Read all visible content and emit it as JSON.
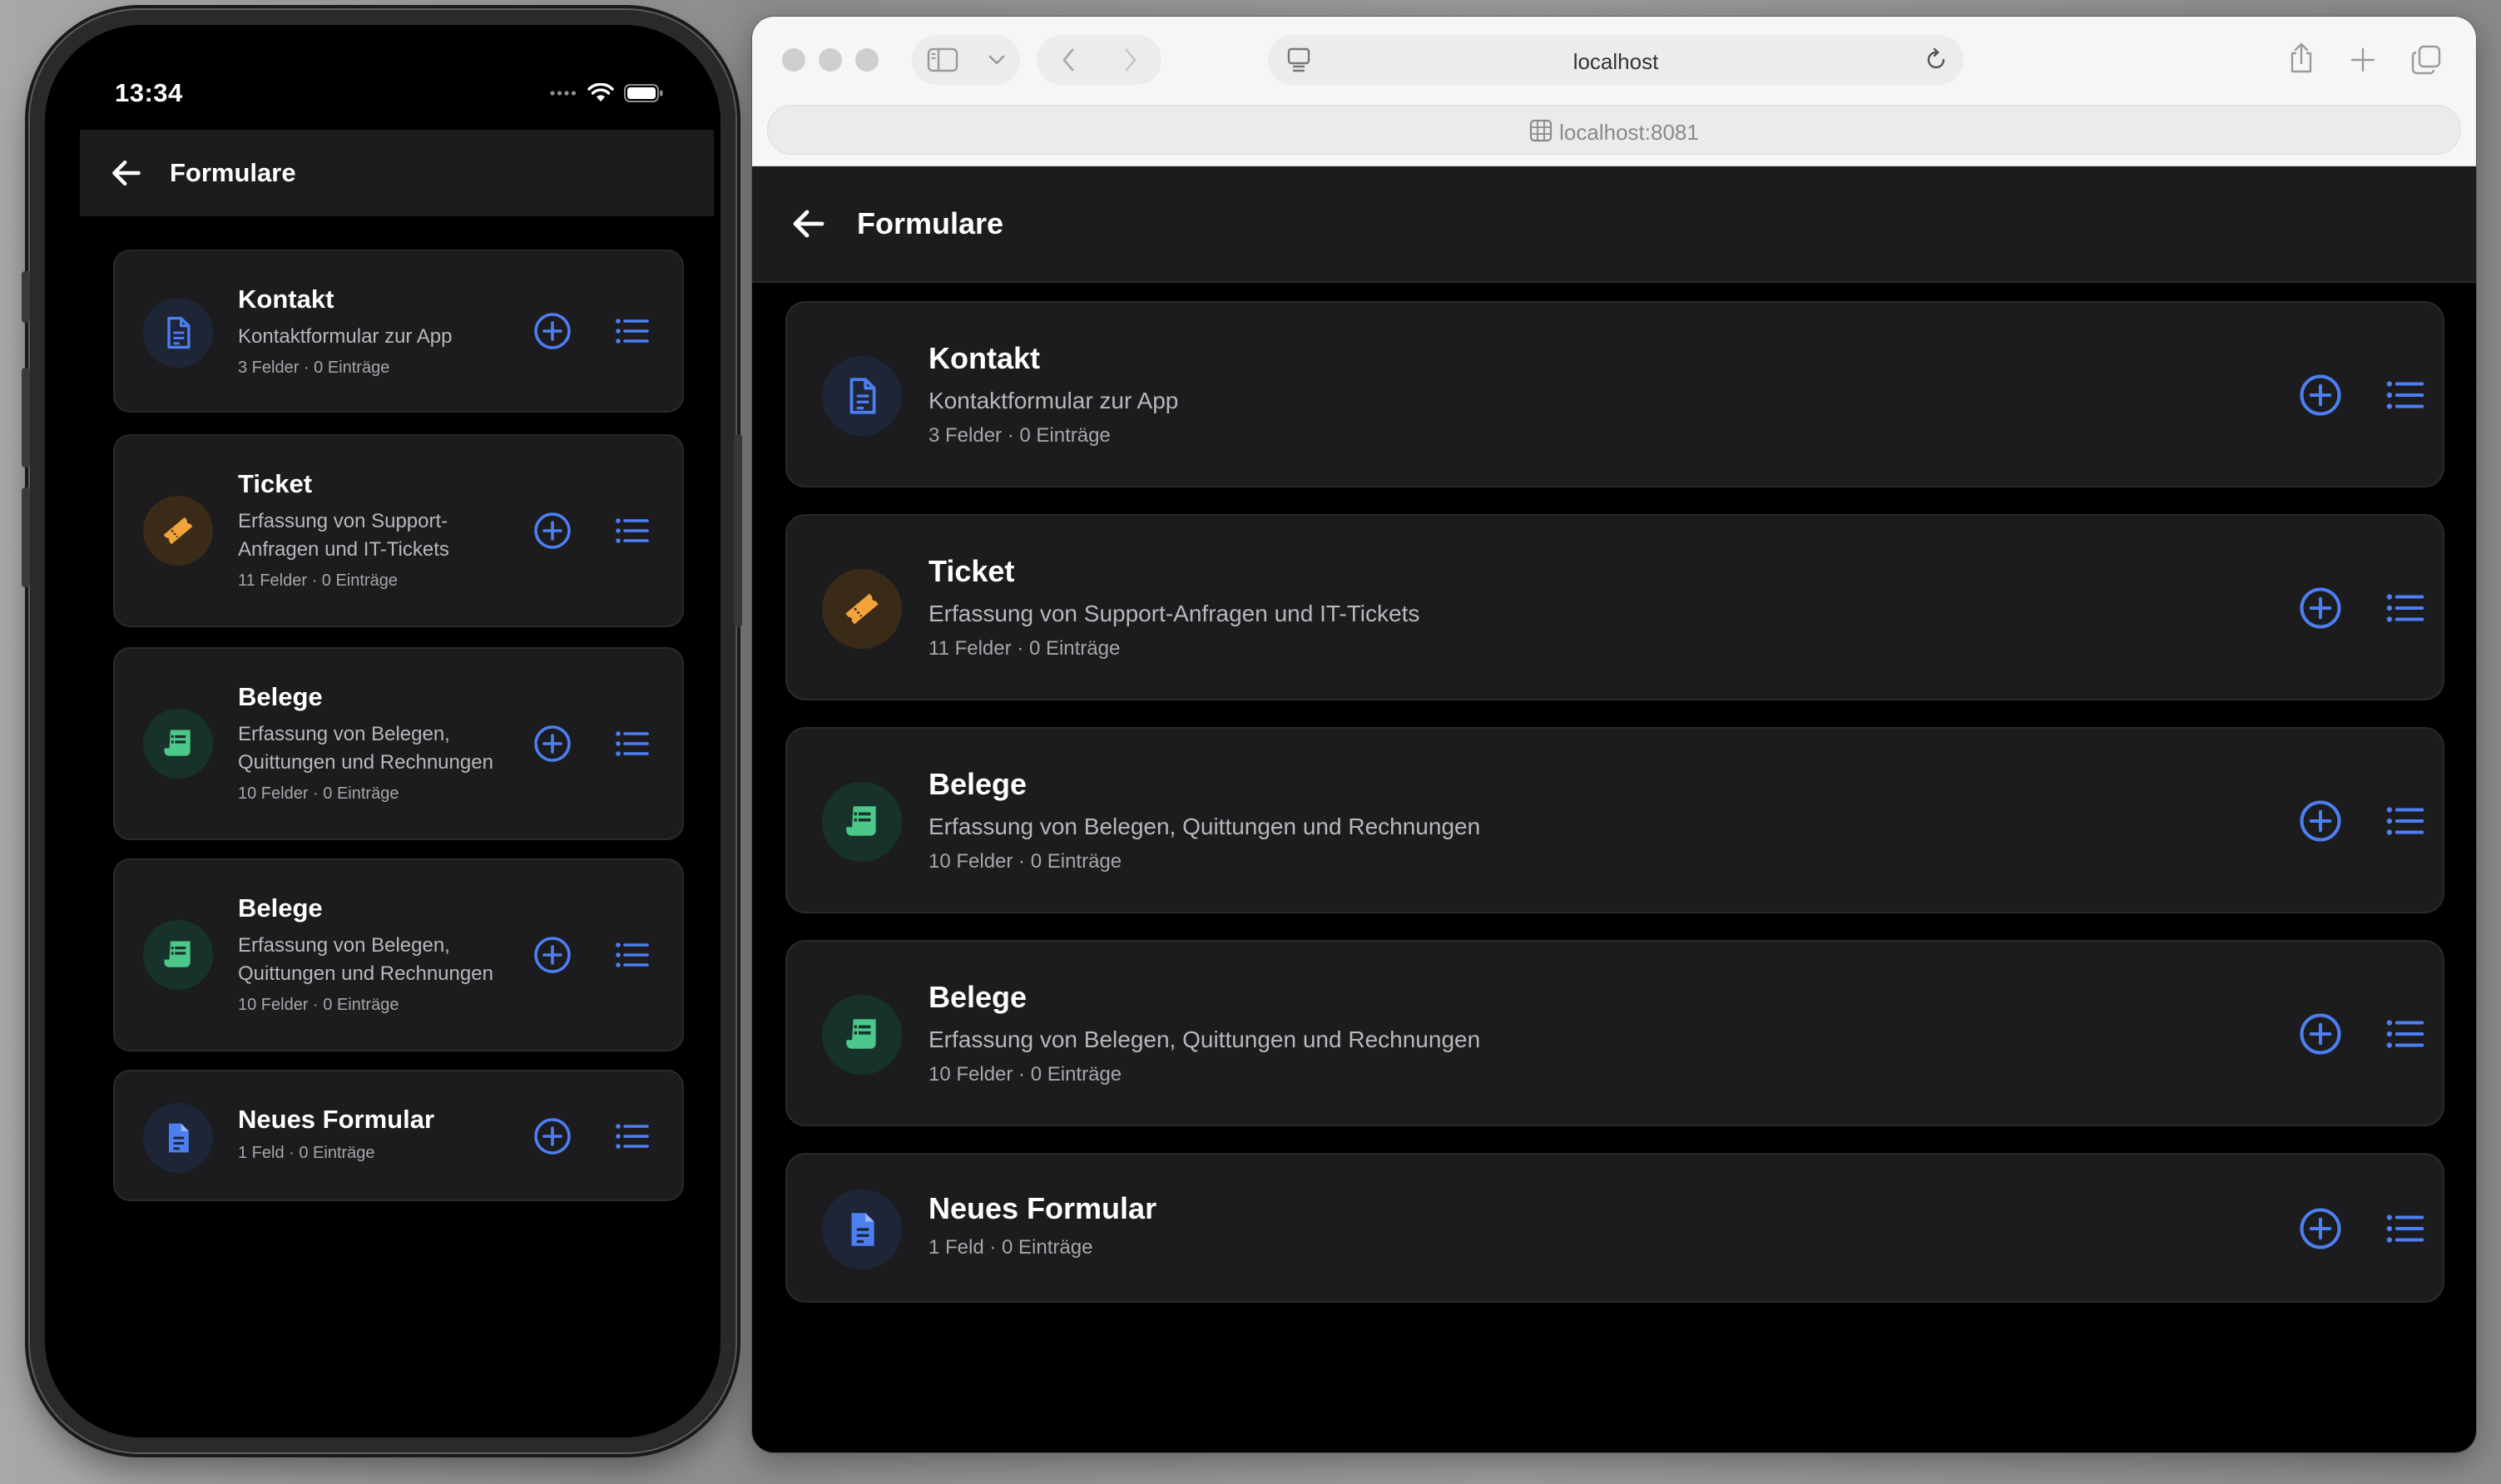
{
  "phone": {
    "status_time": "13:34",
    "appbar_title": "Formulare"
  },
  "browser": {
    "tab_url": "localhost",
    "address": "localhost:8081",
    "appbar_title": "Formulare"
  },
  "forms": [
    {
      "name": "Kontakt",
      "description": "Kontaktformular zur App",
      "phone_desc_lines": [
        "Kontaktformular zur App"
      ],
      "meta": "3 Felder · 0 Einträge",
      "icon": "document-outline-icon",
      "icon_color": "#4d7ff2",
      "icon_bg": "#1e2536"
    },
    {
      "name": "Ticket",
      "description": "Erfassung von Support-Anfragen und IT-Tickets",
      "phone_desc_lines": [
        "Erfassung von Support-",
        "Anfragen und IT-Tickets"
      ],
      "meta": "11 Felder · 0 Einträge",
      "icon": "ticket-icon",
      "icon_color": "#f2a43a",
      "icon_bg": "#3a2a18"
    },
    {
      "name": "Belege",
      "description": "Erfassung von Belegen, Quittungen und Rechnungen",
      "phone_desc_lines": [
        "Erfassung von Belegen,",
        "Quittungen und Rechnungen"
      ],
      "meta": "10 Felder · 0 Einträge",
      "icon": "receipt-icon",
      "icon_color": "#4cc88a",
      "icon_bg": "#17322a"
    },
    {
      "name": "Belege",
      "description": "Erfassung von Belegen, Quittungen und Rechnungen",
      "phone_desc_lines": [
        "Erfassung von Belegen,",
        "Quittungen und Rechnungen"
      ],
      "meta": "10 Felder · 0 Einträge",
      "icon": "receipt-icon",
      "icon_color": "#4cc88a",
      "icon_bg": "#17322a"
    },
    {
      "name": "Neues Formular",
      "description": "",
      "phone_desc_lines": [],
      "meta": "1 Feld · 0 Einträge",
      "icon": "document-filled-icon",
      "icon_color": "#4d7ff2",
      "icon_bg": "#1e2536"
    }
  ],
  "colors": {
    "accent": "#4d7ff2",
    "card_bg": "#1c1c1e",
    "page_bg": "#000000"
  }
}
